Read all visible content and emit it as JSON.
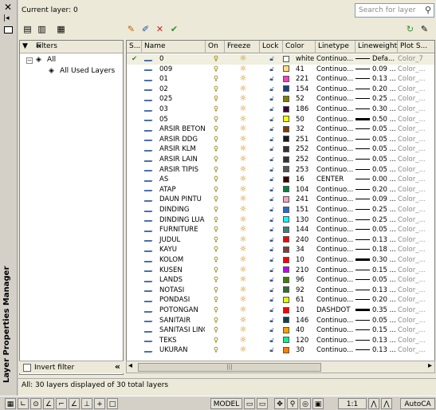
{
  "palette": {
    "title": "Layer Properties Manager",
    "close_icon": "close-icon",
    "auto_hide_icon": "auto-hide-icon",
    "properties_icon": "properties-icon"
  },
  "header": {
    "current_layer": "Current layer: 0",
    "search_placeholder": "Search for layer"
  },
  "toolbar": {
    "new_property_filter": "new-property-filter-icon",
    "new_group_filter": "new-group-filter-icon",
    "layer_states": "layer-states-manager-icon",
    "new_layer": "new-layer-icon",
    "new_layer_vp_frozen": "new-layer-vp-frozen-icon",
    "delete_layer": "delete-layer-icon",
    "set_current": "set-current-icon",
    "refresh": "refresh-icon",
    "settings": "settings-icon"
  },
  "filters": {
    "header": "Filters",
    "tree": [
      {
        "label": "All",
        "expanded": true
      },
      {
        "label": "All Used Layers"
      }
    ],
    "invert_filter": "Invert filter"
  },
  "columns": [
    "S...",
    "Name",
    "On",
    "Freeze",
    "Lock",
    "Color",
    "Linetype",
    "Lineweight",
    "Plot S..."
  ],
  "layers": [
    {
      "name": "0",
      "color_name": "white",
      "color": "#ffffff",
      "linetype": "Continuo...",
      "lineweight": "Defa...",
      "plot": "Color_7",
      "current": true
    },
    {
      "name": "009",
      "color_name": "41",
      "color": "#ffdf7f",
      "linetype": "Continuo...",
      "lineweight": "0.09 ...",
      "plot": "Color_..."
    },
    {
      "name": "01",
      "color_name": "221",
      "color": "#ff3fbf",
      "linetype": "Continuo...",
      "lineweight": "0.13 ...",
      "plot": "Color_..."
    },
    {
      "name": "02",
      "color_name": "154",
      "color": "#1f3f7f",
      "linetype": "Continuo...",
      "lineweight": "0.20 ...",
      "plot": "Color_..."
    },
    {
      "name": "025",
      "color_name": "52",
      "color": "#7f7f00",
      "linetype": "Continuo...",
      "lineweight": "0.25 ...",
      "plot": "Color_..."
    },
    {
      "name": "03",
      "color_name": "186",
      "color": "#3f003f",
      "linetype": "Continuo...",
      "lineweight": "0.30 ...",
      "plot": "Color_..."
    },
    {
      "name": "05",
      "color_name": "50",
      "color": "#ffff00",
      "linetype": "Continuo...",
      "lineweight": "0.50 ...",
      "plot": "Color_...",
      "thick": true
    },
    {
      "name": "ARSIR BETON",
      "color_name": "32",
      "color": "#7f3f00",
      "linetype": "Continuo...",
      "lineweight": "0.05 ...",
      "plot": "Color_..."
    },
    {
      "name": "ARSIR DDG",
      "color_name": "251",
      "color": "#1a1a1a",
      "linetype": "Continuo...",
      "lineweight": "0.05 ...",
      "plot": "Color_..."
    },
    {
      "name": "ARSIR KLM",
      "color_name": "252",
      "color": "#333333",
      "linetype": "Continuo...",
      "lineweight": "0.05 ...",
      "plot": "Color_..."
    },
    {
      "name": "ARSIR LAIN",
      "color_name": "252",
      "color": "#333333",
      "linetype": "Continuo...",
      "lineweight": "0.05 ...",
      "plot": "Color_..."
    },
    {
      "name": "ARSIR TIPIS",
      "color_name": "253",
      "color": "#555555",
      "linetype": "Continuo...",
      "lineweight": "0.05 ...",
      "plot": "Color_..."
    },
    {
      "name": "AS",
      "color_name": "16",
      "color": "#3f0000",
      "linetype": "CENTER",
      "lineweight": "0.00 ...",
      "plot": "Color_..."
    },
    {
      "name": "ATAP",
      "color_name": "104",
      "color": "#007f3f",
      "linetype": "Continuo...",
      "lineweight": "0.20 ...",
      "plot": "Color_..."
    },
    {
      "name": "DAUN PINTU",
      "color_name": "241",
      "color": "#ff9fbf",
      "linetype": "Continuo...",
      "lineweight": "0.09 ...",
      "plot": "Color_..."
    },
    {
      "name": "DINDING",
      "color_name": "151",
      "color": "#2b6bcf",
      "linetype": "Continuo...",
      "lineweight": "0.25 ...",
      "plot": "Color_..."
    },
    {
      "name": "DINDING LUAR",
      "color_name": "130",
      "color": "#00ffff",
      "linetype": "Continuo...",
      "lineweight": "0.25 ...",
      "plot": "Color_..."
    },
    {
      "name": "FURNITURE",
      "color_name": "144",
      "color": "#3f7f7f",
      "linetype": "Continuo...",
      "lineweight": "0.05 ...",
      "plot": "Color_..."
    },
    {
      "name": "JUDUL",
      "color_name": "240",
      "color": "#ff0000",
      "linetype": "Continuo...",
      "lineweight": "0.13 ...",
      "plot": "Color_..."
    },
    {
      "name": "KAYU",
      "color_name": "34",
      "color": "#7f3f3f",
      "linetype": "Continuo...",
      "lineweight": "0.18 ...",
      "plot": "Color_..."
    },
    {
      "name": "KOLOM",
      "color_name": "10",
      "color": "#ff0000",
      "linetype": "Continuo...",
      "lineweight": "0.30 ...",
      "plot": "Color_...",
      "thick": true
    },
    {
      "name": "KUSEN",
      "color_name": "210",
      "color": "#bf00ff",
      "linetype": "Continuo...",
      "lineweight": "0.15 ...",
      "plot": "Color_..."
    },
    {
      "name": "LANDS",
      "color_name": "96",
      "color": "#3f7f00",
      "linetype": "Continuo...",
      "lineweight": "0.05 ...",
      "plot": "Color_..."
    },
    {
      "name": "NOTASI",
      "color_name": "92",
      "color": "#2f6f2f",
      "linetype": "Continuo...",
      "lineweight": "0.13 ...",
      "plot": "Color_..."
    },
    {
      "name": "PONDASI",
      "color_name": "61",
      "color": "#dfff00",
      "linetype": "Continuo...",
      "lineweight": "0.20 ...",
      "plot": "Color_..."
    },
    {
      "name": "POTONGAN",
      "color_name": "10",
      "color": "#ff0000",
      "linetype": "DASHDOT",
      "lineweight": "0.35 ...",
      "plot": "Color_...",
      "thick": true
    },
    {
      "name": "SANITAIR",
      "color_name": "146",
      "color": "#0f3f4f",
      "linetype": "Continuo...",
      "lineweight": "0.05 ...",
      "plot": "Color_..."
    },
    {
      "name": "SANITASI LINGK",
      "color_name": "40",
      "color": "#ff9f00",
      "linetype": "Continuo...",
      "lineweight": "0.15 ...",
      "plot": "Color_..."
    },
    {
      "name": "TEKS",
      "color_name": "120",
      "color": "#00ff7f",
      "linetype": "Continuo...",
      "lineweight": "0.13 ...",
      "plot": "Color_..."
    },
    {
      "name": "UKURAN",
      "color_name": "30",
      "color": "#ff7f00",
      "linetype": "Continuo...",
      "lineweight": "0.13 ...",
      "plot": "Color_..."
    }
  ],
  "status": "All: 30 layers displayed of 30 total layers",
  "taskbar": {
    "model": "MODEL",
    "scale": "1:1",
    "app": "AutoCA"
  }
}
